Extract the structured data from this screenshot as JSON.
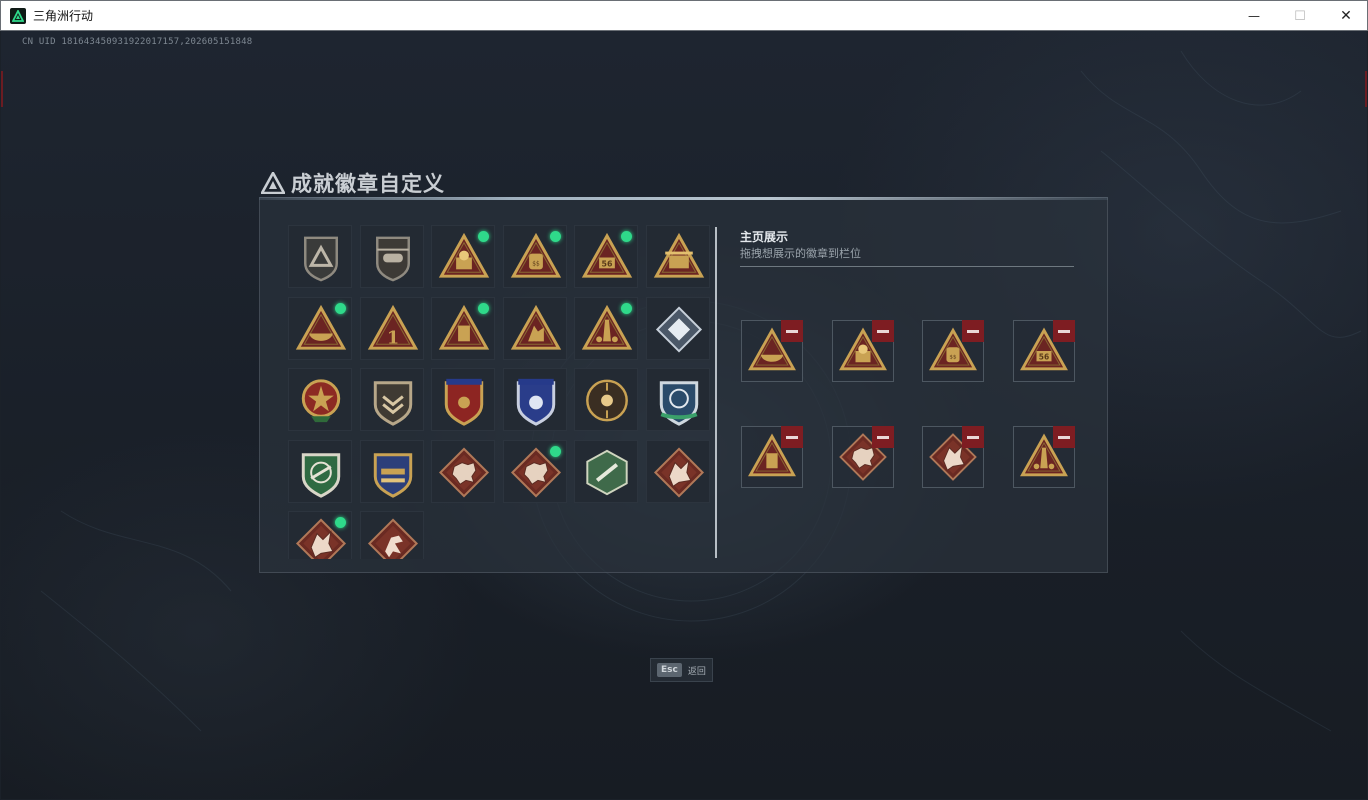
{
  "window": {
    "title": "三角洲行动",
    "minimize_glyph": "—",
    "maximize_glyph": "☐",
    "close_glyph": "✕"
  },
  "uid_text": "CN UID 181643450931922017157,202605151848",
  "panel": {
    "title": "成就徽章自定义",
    "badges": [
      {
        "icon": "shield-delta-badge",
        "new": false
      },
      {
        "icon": "helicopter-badge",
        "new": false
      },
      {
        "icon": "triangle-emblem-badge",
        "new": true
      },
      {
        "icon": "triangle-bag-badge",
        "new": true
      },
      {
        "icon": "triangle-56-badge",
        "new": true
      },
      {
        "icon": "triangle-crate-badge",
        "new": false
      },
      {
        "icon": "triangle-bowl-badge",
        "new": true
      },
      {
        "icon": "triangle-number-one-badge",
        "new": false
      },
      {
        "icon": "triangle-tank-badge",
        "new": true
      },
      {
        "icon": "triangle-soldier-badge",
        "new": false
      },
      {
        "icon": "triangle-tower-badge",
        "new": true
      },
      {
        "icon": "diamond-silver-badge",
        "new": false
      },
      {
        "icon": "star-medal-badge",
        "new": false
      },
      {
        "icon": "shield-chevron-badge",
        "new": false
      },
      {
        "icon": "shield-stars-red-badge",
        "new": false
      },
      {
        "icon": "shield-stars-blue-badge",
        "new": false
      },
      {
        "icon": "round-crosshair-badge",
        "new": false
      },
      {
        "icon": "shield-blue-green-badge",
        "new": false
      },
      {
        "icon": "shield-green-rifle-badge",
        "new": false
      },
      {
        "icon": "shield-blue-gold-badge",
        "new": false
      },
      {
        "icon": "diamond-beast-badge",
        "new": false
      },
      {
        "icon": "diamond-beast-badge",
        "new": true
      },
      {
        "icon": "hexagon-weapon-badge",
        "new": false
      },
      {
        "icon": "diamond-dragon-badge",
        "new": false
      },
      {
        "icon": "diamond-dragon-badge",
        "new": true
      },
      {
        "icon": "diamond-runner-badge",
        "new": false
      }
    ],
    "showcase": {
      "heading": "主页展示",
      "subheading": "拖拽想展示的徽章到栏位",
      "slots": [
        {
          "icon": "triangle-bowl-badge"
        },
        {
          "icon": "triangle-emblem-badge"
        },
        {
          "icon": "triangle-bag-badge"
        },
        {
          "icon": "triangle-56-badge"
        },
        {
          "icon": "triangle-tank-badge"
        },
        {
          "icon": "diamond-beast-badge"
        },
        {
          "icon": "diamond-dragon-badge"
        },
        {
          "icon": "triangle-tower-badge"
        }
      ]
    }
  },
  "footer": {
    "key": "Esc",
    "label": "返回"
  },
  "colors": {
    "new_dot": "#2fd98a",
    "remove_bg": "#7e1d22",
    "gold": "#c9a253",
    "crimson": "#6b2422"
  }
}
